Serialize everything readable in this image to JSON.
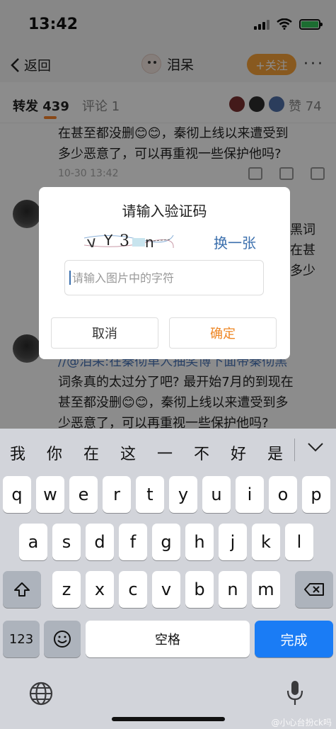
{
  "status": {
    "time": "13:42"
  },
  "nav": {
    "back_label": "返回",
    "title": "泪呆",
    "follow_label": "+关注",
    "more": "···"
  },
  "tabs": {
    "repost": "转发 439",
    "comment": "评论 1",
    "like": "赞 74"
  },
  "posts": {
    "first_line1": "在甚至都没删😊😊，秦彻上线以来遭受到",
    "first_line2": "多少恶意了，可以再重视一些保护他吗?",
    "first_meta": "10-30 13:42",
    "second_frag1": "黑词",
    "second_frag2": "在甚",
    "second_frag3": "多少",
    "third_line1": "//@泪呆:在秦彻单人抽奖博下面带秦彻黑",
    "third_line2": "词条真的太过分了吧? 最开始7月的到现在",
    "third_line3": "甚至都没删😊😊，秦彻上线以来遭受到多",
    "third_line4": "少恶意了，可以再重视一些保护他吗?"
  },
  "dialog": {
    "title": "请输入验证码",
    "refresh_label": "换一张",
    "input_placeholder": "请输入图片中的字符",
    "cancel_label": "取消",
    "confirm_label": "确定"
  },
  "keyboard": {
    "suggestions": [
      "我",
      "你",
      "在",
      "这",
      "一",
      "不",
      "好",
      "是"
    ],
    "row1": [
      "q",
      "w",
      "e",
      "r",
      "t",
      "y",
      "u",
      "i",
      "o",
      "p"
    ],
    "row2": [
      "a",
      "s",
      "d",
      "f",
      "g",
      "h",
      "j",
      "k",
      "l"
    ],
    "row3": [
      "z",
      "x",
      "c",
      "v",
      "b",
      "n",
      "m"
    ],
    "numbers_label": "123",
    "space_label": "空格",
    "done_label": "完成"
  },
  "watermark": "@小心台扮ck吗",
  "colors": {
    "accent_orange": "#ee8522",
    "link_blue": "#3b6fad",
    "done_blue": "#1a7cf5"
  }
}
